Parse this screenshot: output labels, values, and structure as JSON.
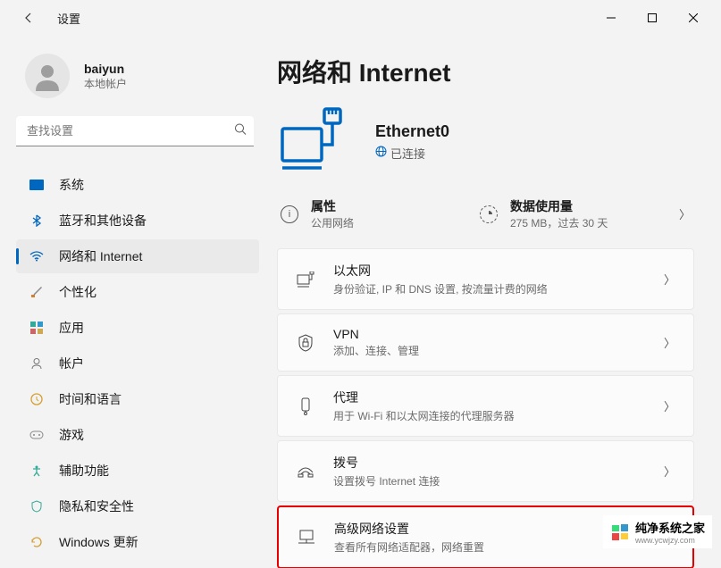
{
  "window": {
    "title": "设置"
  },
  "user": {
    "name": "baiyun",
    "account_type": "本地帐户"
  },
  "search": {
    "placeholder": "查找设置"
  },
  "sidebar": {
    "items": [
      {
        "label": "系统"
      },
      {
        "label": "蓝牙和其他设备"
      },
      {
        "label": "网络和 Internet"
      },
      {
        "label": "个性化"
      },
      {
        "label": "应用"
      },
      {
        "label": "帐户"
      },
      {
        "label": "时间和语言"
      },
      {
        "label": "游戏"
      },
      {
        "label": "辅助功能"
      },
      {
        "label": "隐私和安全性"
      },
      {
        "label": "Windows 更新"
      }
    ]
  },
  "page": {
    "title": "网络和 Internet",
    "network": {
      "name": "Ethernet0",
      "state": "已连接"
    },
    "stats": {
      "properties": {
        "title": "属性",
        "sub": "公用网络"
      },
      "usage": {
        "title": "数据使用量",
        "sub": "275 MB，过去 30 天"
      }
    },
    "settings": [
      {
        "title": "以太网",
        "desc": "身份验证, IP 和 DNS 设置, 按流量计费的网络"
      },
      {
        "title": "VPN",
        "desc": "添加、连接、管理"
      },
      {
        "title": "代理",
        "desc": "用于 Wi-Fi 和以太网连接的代理服务器"
      },
      {
        "title": "拨号",
        "desc": "设置拨号 Internet 连接"
      },
      {
        "title": "高级网络设置",
        "desc": "查看所有网络适配器，网络重置"
      }
    ]
  },
  "watermark": {
    "text": "纯净系统之家",
    "url": "www.ycwjzy.com"
  }
}
